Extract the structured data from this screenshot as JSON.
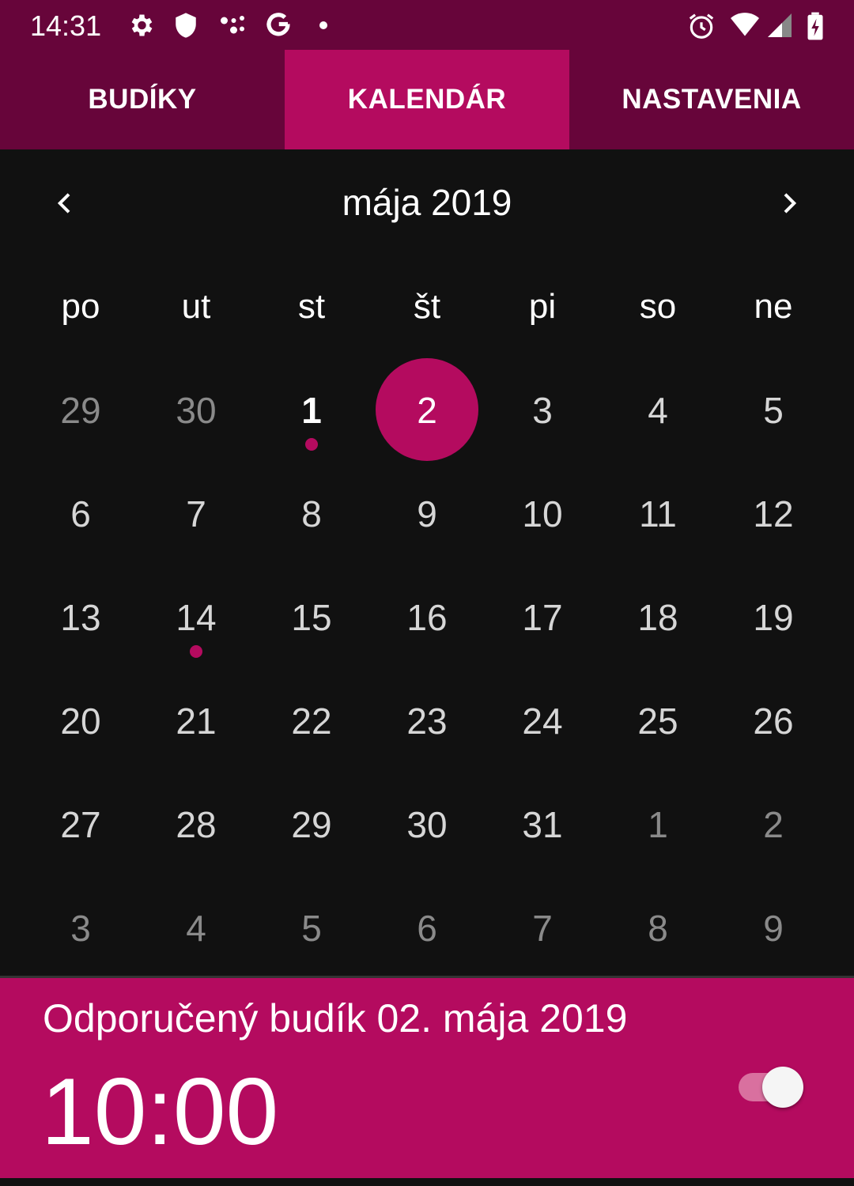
{
  "status_bar": {
    "time": "14:31",
    "left_icons": [
      "gear-icon",
      "shield-icon",
      "dots-icon",
      "google-g-icon",
      "dot-icon"
    ],
    "right_icons": [
      "alarm-icon",
      "wifi-icon",
      "signal-icon",
      "battery-charging-icon"
    ]
  },
  "tabs": [
    {
      "label": "BUDÍKY",
      "active": false
    },
    {
      "label": "KALENDÁR",
      "active": true
    },
    {
      "label": "NASTAVENIA",
      "active": false
    }
  ],
  "calendar": {
    "month_title": "mája 2019",
    "prev_icon": "chevron-left-icon",
    "next_icon": "chevron-right-icon",
    "weekdays": [
      "po",
      "ut",
      "st",
      "št",
      "pi",
      "so",
      "ne"
    ],
    "weeks": [
      [
        {
          "d": "29",
          "other": true
        },
        {
          "d": "30",
          "other": true
        },
        {
          "d": "1",
          "bold": true,
          "dot": true
        },
        {
          "d": "2",
          "selected": true
        },
        {
          "d": "3"
        },
        {
          "d": "4"
        },
        {
          "d": "5"
        }
      ],
      [
        {
          "d": "6"
        },
        {
          "d": "7"
        },
        {
          "d": "8"
        },
        {
          "d": "9"
        },
        {
          "d": "10"
        },
        {
          "d": "11"
        },
        {
          "d": "12"
        }
      ],
      [
        {
          "d": "13"
        },
        {
          "d": "14",
          "dot": true
        },
        {
          "d": "15"
        },
        {
          "d": "16"
        },
        {
          "d": "17"
        },
        {
          "d": "18"
        },
        {
          "d": "19"
        }
      ],
      [
        {
          "d": "20"
        },
        {
          "d": "21"
        },
        {
          "d": "22"
        },
        {
          "d": "23"
        },
        {
          "d": "24"
        },
        {
          "d": "25"
        },
        {
          "d": "26"
        }
      ],
      [
        {
          "d": "27"
        },
        {
          "d": "28"
        },
        {
          "d": "29"
        },
        {
          "d": "30"
        },
        {
          "d": "31"
        },
        {
          "d": "1",
          "other": true
        },
        {
          "d": "2",
          "other": true
        }
      ],
      [
        {
          "d": "3",
          "other": true
        },
        {
          "d": "4",
          "other": true
        },
        {
          "d": "5",
          "other": true
        },
        {
          "d": "6",
          "other": true
        },
        {
          "d": "7",
          "other": true
        },
        {
          "d": "8",
          "other": true
        },
        {
          "d": "9",
          "other": true
        }
      ]
    ]
  },
  "alarm": {
    "title": "Odporučený budík 02. mája 2019",
    "time": "10:00",
    "enabled": true
  },
  "colors": {
    "accent": "#b40b5f",
    "header_bg": "#67053a",
    "background": "#111111"
  }
}
